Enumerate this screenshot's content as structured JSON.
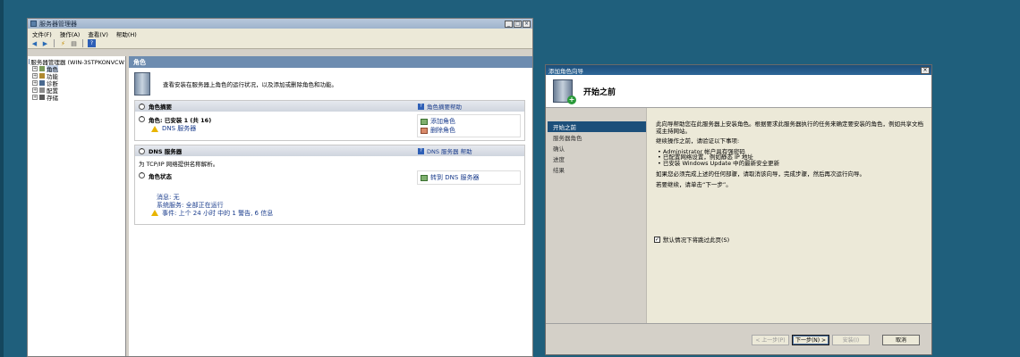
{
  "server_manager": {
    "title": "服务器管理器",
    "window_buttons": [
      "_",
      "□",
      "×"
    ],
    "menu": [
      "文件(F)",
      "操作(A)",
      "查看(V)",
      "帮助(H)"
    ],
    "tree": [
      {
        "label": "服务器管理器 (WIN-3STPKONVCW",
        "expander": ""
      },
      {
        "label": "角色",
        "expander": "+",
        "selected": true
      },
      {
        "label": "功能",
        "expander": "+"
      },
      {
        "label": "诊断",
        "expander": "+"
      },
      {
        "label": "配置",
        "expander": "+"
      },
      {
        "label": "存储",
        "expander": "+"
      }
    ],
    "header": "角色",
    "intro": "查看安装在服务器上角色的运行状况，以及添加或删除角色和功能。",
    "roles_summary": {
      "title": "角色摘要",
      "help": "角色摘要帮助",
      "installed": "角色: 已安装 1 (共 16)",
      "dns_server": "DNS 服务器",
      "add_roles": "添加角色",
      "remove_roles": "删除角色"
    },
    "dns_section": {
      "title": "DNS 服务器",
      "help": "DNS 服务器 帮助",
      "description": "为 TCP/IP 网络提供名称解析。",
      "role_status": "角色状态",
      "goto": "转到 DNS 服务器",
      "messages": "消息: 无",
      "system_services": "系统服务: 全部正在运行",
      "events": "事件: 上个 24 小时 中的 1 警告, 6 信息"
    }
  },
  "wizard": {
    "title": "添加角色向导",
    "close": "×",
    "page_title": "开始之前",
    "steps": [
      {
        "label": "开始之前",
        "active": true
      },
      {
        "label": "服务器角色"
      },
      {
        "label": "确认"
      },
      {
        "label": "进度"
      },
      {
        "label": "结果"
      }
    ],
    "para1": "此向导帮助您在此服务器上安装角色。根据要求此服务器执行的任务来确定要安装的角色，例如共享文档或主持网站。",
    "para2": "继续操作之前，请验证以下事项:",
    "bullets": [
      "• Administrator 帐户具有强密码",
      "• 已配置网络设置，例如静态 IP 地址",
      "• 已安装 Windows Update 中的最新安全更新"
    ],
    "para3": "如果您必须完成上述的任何部骤，请取消该向导，完成步骤，然后再次运行向导。",
    "para4": "若要继续，请单击“下一步”。",
    "skip_label": "默认情况下将跳过此页(S)",
    "buttons": {
      "back": "< 上一步(P)",
      "next": "下一步(N) >",
      "install": "安装(I)",
      "cancel": "取消"
    }
  }
}
